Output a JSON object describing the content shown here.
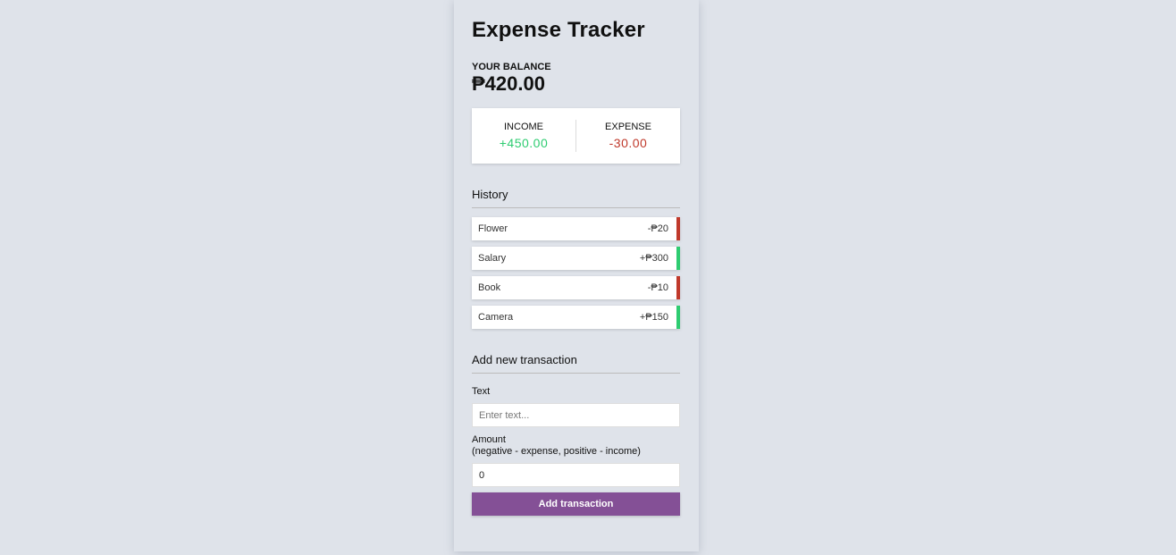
{
  "header": {
    "title": "Expense Tracker"
  },
  "balance": {
    "label": "Your Balance",
    "value": "₱420.00"
  },
  "summary": {
    "income_label": "Income",
    "income_value": "+450.00",
    "expense_label": "Expense",
    "expense_value": "-30.00"
  },
  "history": {
    "heading": "History",
    "items": [
      {
        "text": "Flower",
        "amount": "-₱20",
        "type": "minus"
      },
      {
        "text": "Salary",
        "amount": "+₱300",
        "type": "plus"
      },
      {
        "text": "Book",
        "amount": "-₱10",
        "type": "minus"
      },
      {
        "text": "Camera",
        "amount": "+₱150",
        "type": "plus"
      }
    ]
  },
  "form": {
    "heading": "Add new transaction",
    "text_label": "Text",
    "text_placeholder": "Enter text...",
    "text_value": "",
    "amount_label": "Amount",
    "amount_hint": "(negative - expense, positive - income)",
    "amount_value": "0",
    "submit_label": "Add transaction"
  },
  "colors": {
    "background": "#dfe3ea",
    "income": "#2ecc71",
    "expense": "#c0392b",
    "button": "#845096"
  }
}
